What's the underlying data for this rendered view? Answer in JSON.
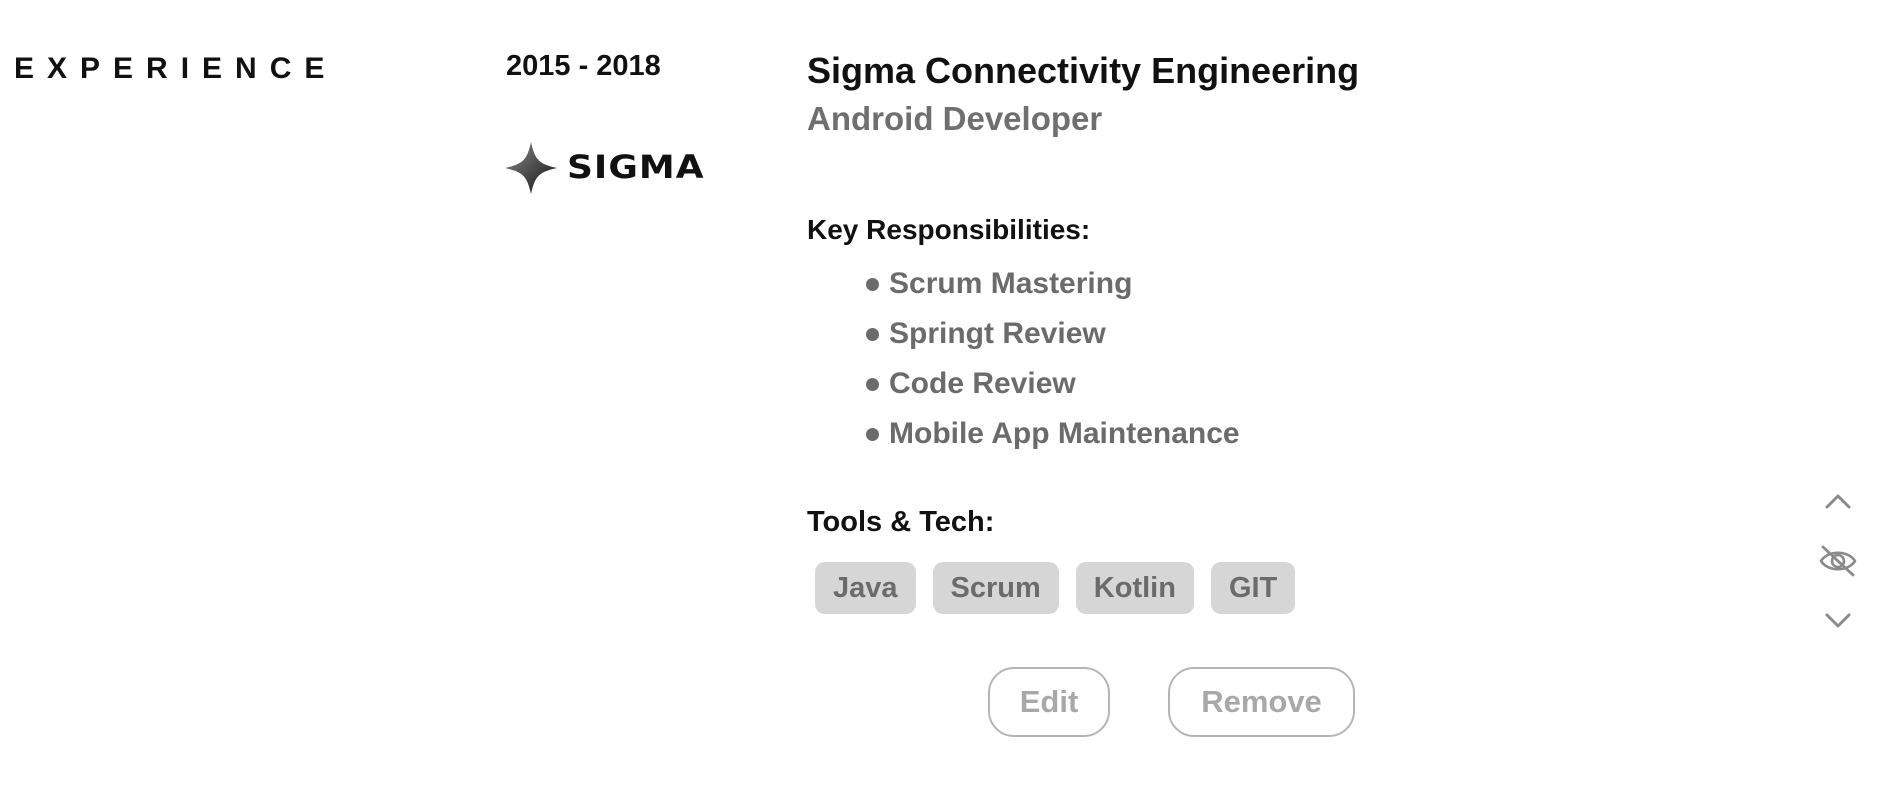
{
  "section": {
    "title": "EXPERIENCE"
  },
  "entry": {
    "years": "2015 - 2018",
    "logo": {
      "icon": "sigma-star-logo-icon",
      "text": "SIGMA"
    },
    "company": "Sigma Connectivity Engineering",
    "role": "Android Developer",
    "responsibilities_label": "Key Responsibilities:",
    "responsibilities": [
      "Scrum Mastering",
      "Springt Review",
      "Code Review",
      "Mobile App Maintenance"
    ],
    "tools_label": "Tools & Tech:",
    "tools": [
      "Java",
      "Scrum",
      "Kotlin",
      "GIT"
    ]
  },
  "actions": {
    "edit_label": "Edit",
    "remove_label": "Remove"
  },
  "controls": {
    "move_up_icon": "chevron-up-icon",
    "hide_icon": "eye-off-icon",
    "move_down_icon": "chevron-down-icon"
  },
  "colors": {
    "text_primary": "#111111",
    "text_secondary": "#6b6b6b",
    "tag_background": "#d6d6d6",
    "button_border": "#b5b5b5",
    "button_text": "#a8a8a8",
    "icon": "#8a8a8a"
  }
}
